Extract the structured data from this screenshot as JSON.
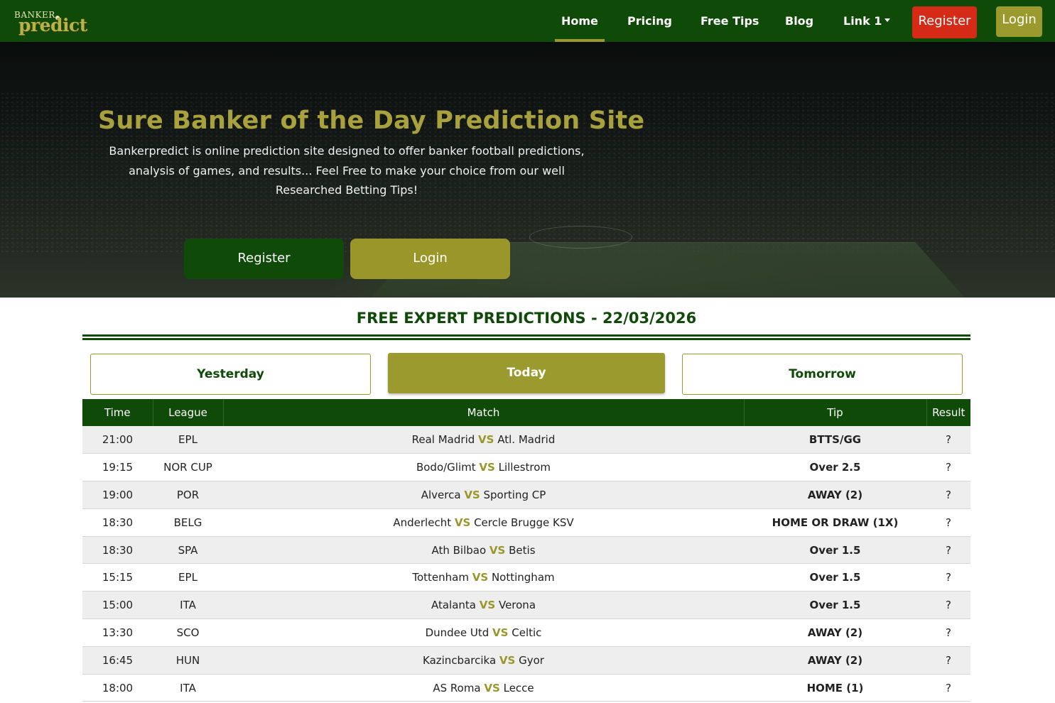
{
  "brand": {
    "logo_top": "BANKER",
    "logo_main": "predict"
  },
  "nav": {
    "items": [
      {
        "label": "Home",
        "active": true
      },
      {
        "label": "Pricing"
      },
      {
        "label": "Free Tips"
      },
      {
        "label": "Blog"
      },
      {
        "label": "Link 1"
      }
    ],
    "register_label": "Register",
    "login_label": "Login"
  },
  "hero": {
    "title": "Sure Banker of the Day Prediction Site",
    "text": "Bankerpredict is online prediction site designed to offer banker football predictions, analysis of games, and results... Feel Free to make your choice from our well Researched Betting Tips!",
    "register_label": "Register",
    "login_label": "Login"
  },
  "predictions": {
    "title": "FREE EXPERT PREDICTIONS - 22/03/2026",
    "tabs": {
      "yesterday": "Yesterday",
      "today": "Today",
      "tomorrow": "Tomorrow",
      "selected": "Today"
    },
    "columns": {
      "time": "Time",
      "league": "League",
      "match": "Match",
      "tip": "Tip",
      "result": "Result"
    },
    "vs_label": "VS",
    "rows": [
      {
        "time": "21:00",
        "league": "EPL",
        "home": "Real Madrid",
        "away": "Atl. Madrid",
        "tip": "BTTS/GG",
        "result": "?"
      },
      {
        "time": "19:15",
        "league": "NOR CUP",
        "home": "Bodo/Glimt",
        "away": "Lillestrom",
        "tip": "Over 2.5",
        "result": "?"
      },
      {
        "time": "19:00",
        "league": "POR",
        "home": "Alverca",
        "away": "Sporting CP",
        "tip": "AWAY (2)",
        "result": "?"
      },
      {
        "time": "18:30",
        "league": "BELG",
        "home": "Anderlecht",
        "away": "Cercle Brugge KSV",
        "tip": "HOME OR DRAW (1X)",
        "result": "?"
      },
      {
        "time": "18:30",
        "league": "SPA",
        "home": "Ath Bilbao",
        "away": "Betis",
        "tip": "Over 1.5",
        "result": "?"
      },
      {
        "time": "15:15",
        "league": "EPL",
        "home": "Tottenham",
        "away": "Nottingham",
        "tip": "Over 1.5",
        "result": "?"
      },
      {
        "time": "15:00",
        "league": "ITA",
        "home": "Atalanta",
        "away": "Verona",
        "tip": "Over 1.5",
        "result": "?"
      },
      {
        "time": "13:30",
        "league": "SCO",
        "home": "Dundee Utd",
        "away": "Celtic",
        "tip": "AWAY (2)",
        "result": "?"
      },
      {
        "time": "16:45",
        "league": "HUN",
        "home": "Kazincbarcika",
        "away": "Gyor",
        "tip": "AWAY (2)",
        "result": "?"
      },
      {
        "time": "18:00",
        "league": "ITA",
        "home": "AS Roma",
        "away": "Lecce",
        "tip": "HOME (1)",
        "result": "?"
      }
    ]
  },
  "colors": {
    "primary_green": "#0f4a08",
    "olive": "#9b9a2f",
    "red": "#d42a16"
  }
}
